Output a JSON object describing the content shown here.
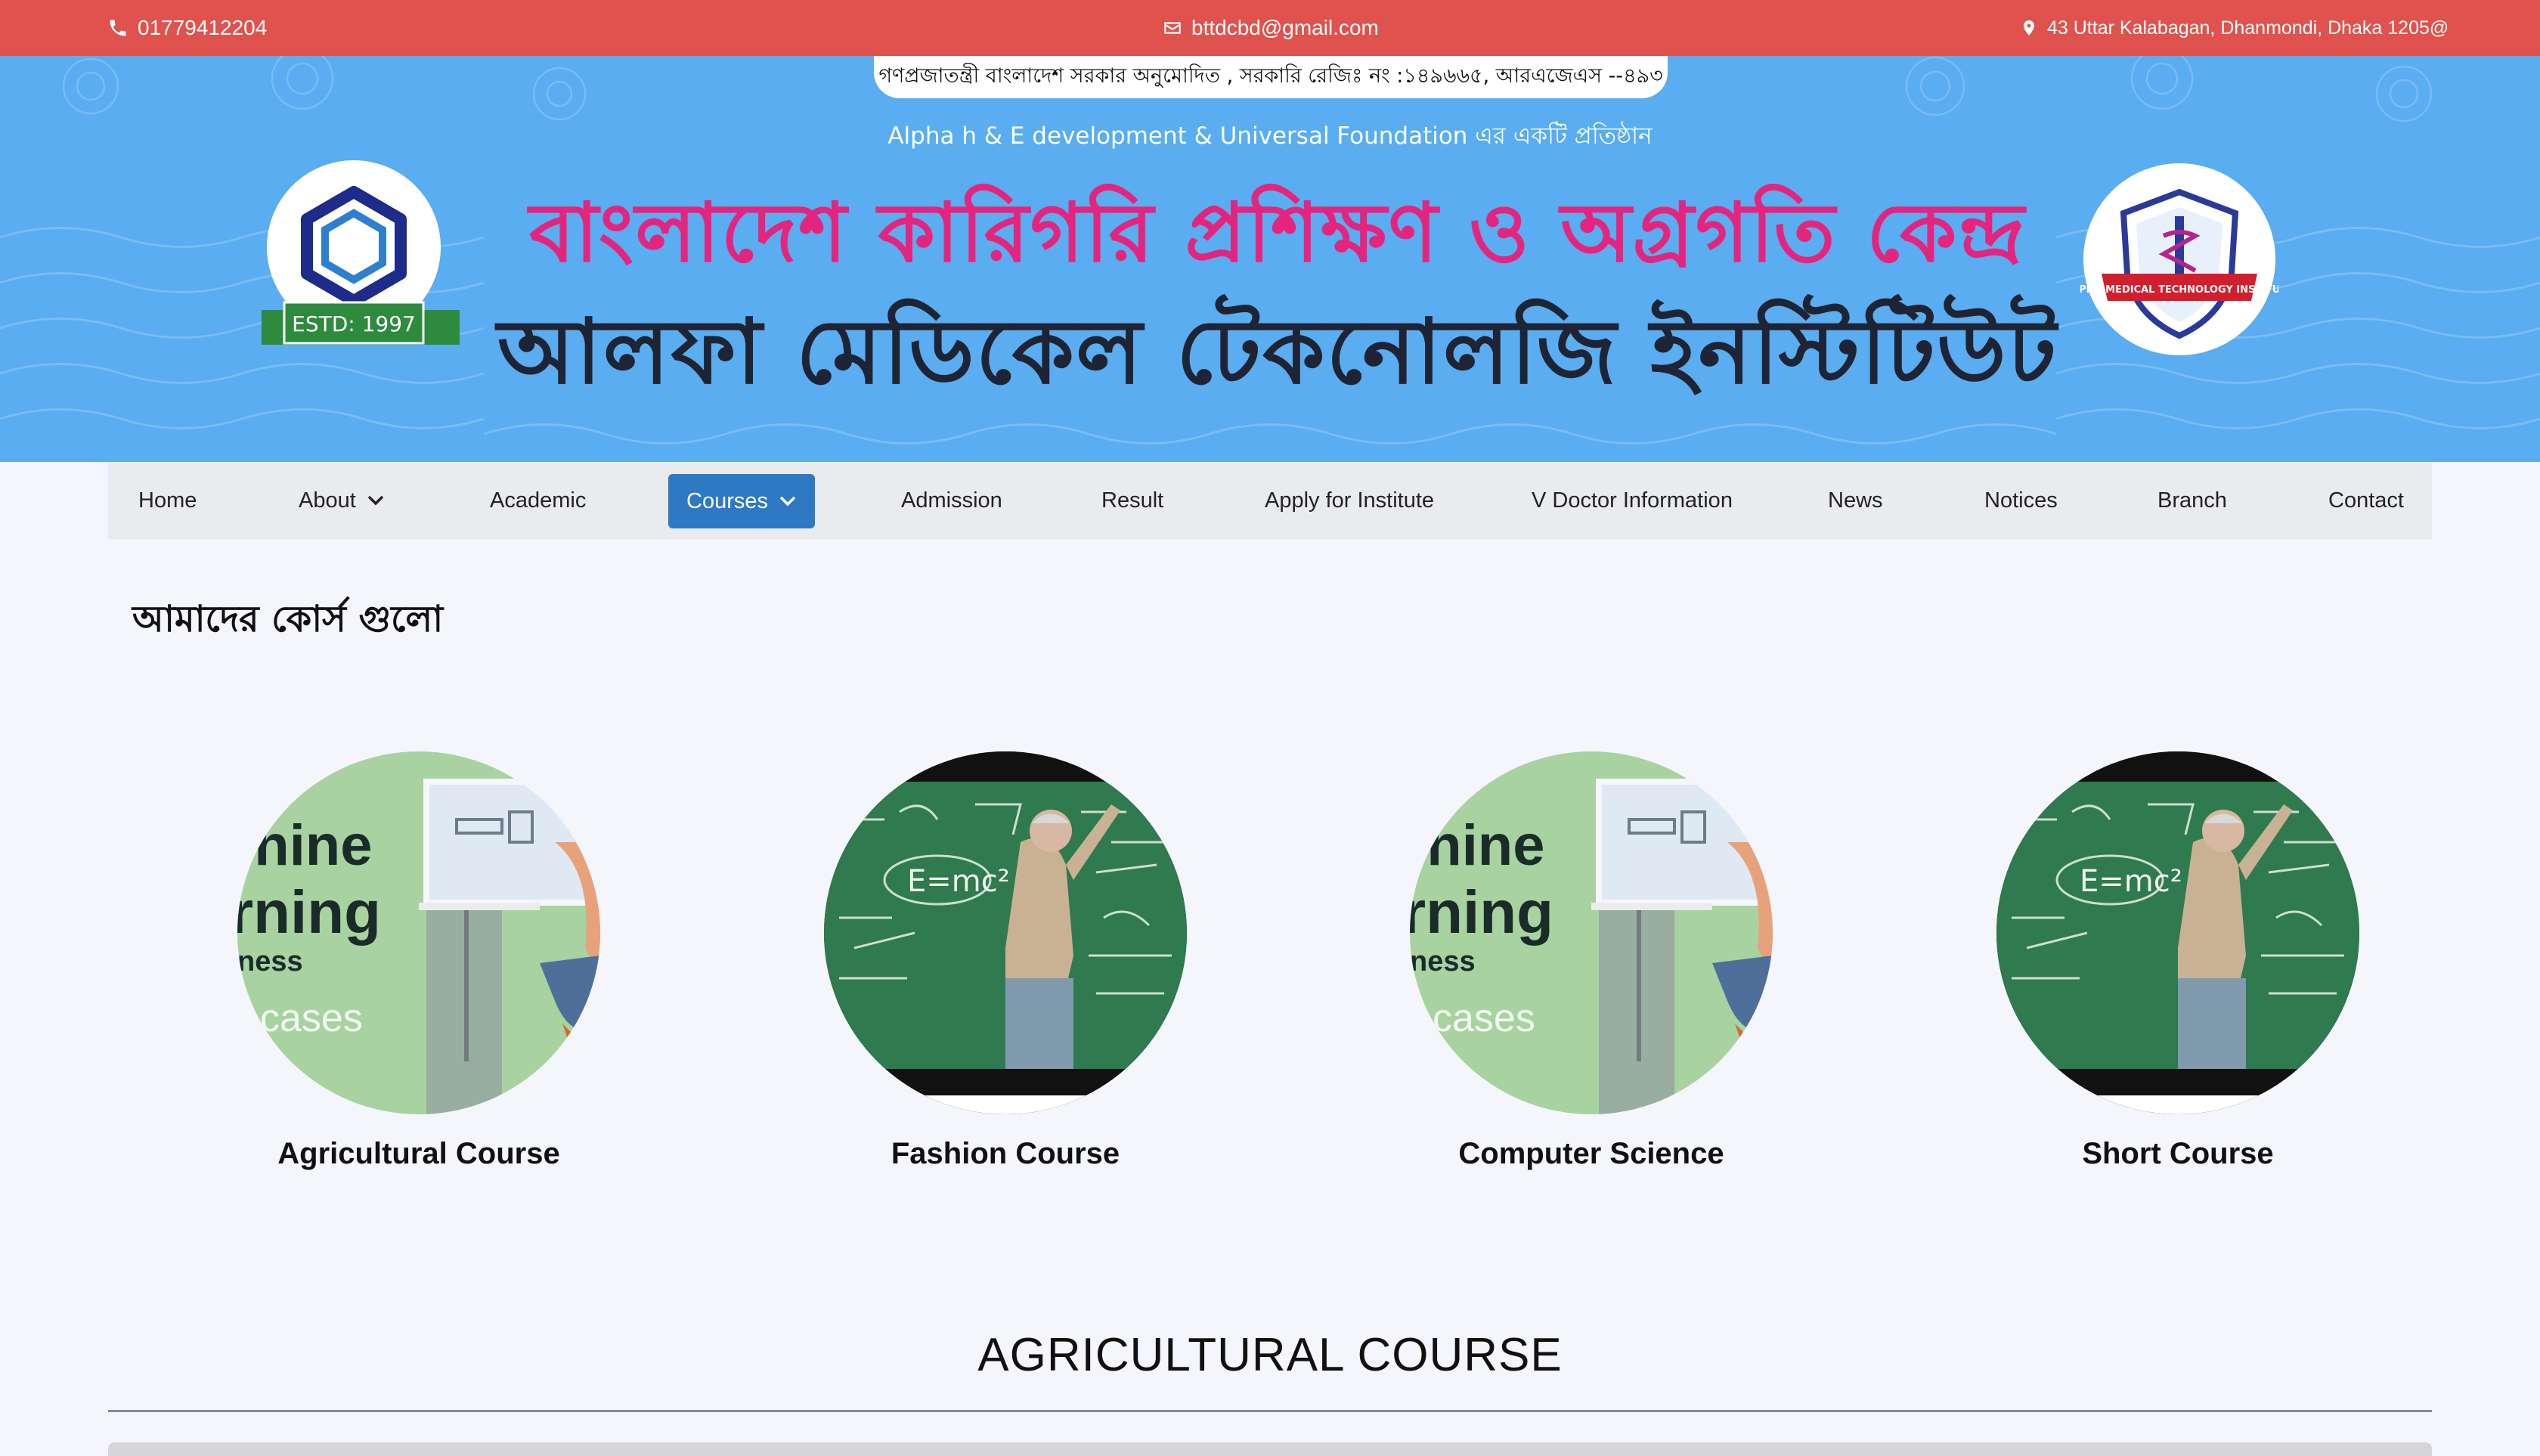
{
  "topbar": {
    "phone": "01779412204",
    "email": "bttdcbd@gmail.com",
    "address": "43 Uttar Kalabagan, Dhanmondi, Dhaka 1205@",
    "icons": [
      "phone-icon",
      "envelope-icon",
      "map-pin-icon"
    ]
  },
  "banner": {
    "gov_notice": "গণপ্রজাতন্ত্রী বাংলাদেশ সরকার অনুমোদিত , সরকারি রেজিঃ নং :১৪৯৬৬৫, আরএজেএস --৪৯৩",
    "subtitle": "Alpha h & E development & Universal Foundation এর একটি প্রতিষ্ঠান",
    "title_line1": "বাংলাদেশ কারিগরি প্রশিক্ষণ ও অগ্রগতি কেন্দ্র",
    "title_line2": "আলফা মেডিকেল টেকনোলজি ইনস্টিটিউট",
    "left_logo_text": "ESTD: 1997",
    "right_logo_text": "ALPHA MEDICAL TECHNOLOGY INSTITUTE",
    "colors": {
      "background": "#59adf0",
      "title1": "#e5257d",
      "title2": "#1e2434"
    }
  },
  "nav": {
    "items": [
      {
        "label": "Home"
      },
      {
        "label": "About",
        "dropdown": true
      },
      {
        "label": "Academic"
      },
      {
        "label": "Courses",
        "dropdown": true,
        "active": true
      },
      {
        "label": "Admission"
      },
      {
        "label": "Result"
      },
      {
        "label": "Apply for Institute"
      },
      {
        "label": "V Doctor Information"
      },
      {
        "label": "News"
      },
      {
        "label": "Notices"
      },
      {
        "label": "Branch"
      },
      {
        "label": "Contact"
      }
    ],
    "active_color": "#2f78c3"
  },
  "courses": {
    "heading": "আমাদের কোর্স গুলো",
    "items": [
      {
        "title": "Agricultural Course",
        "image": "machine-learning-illustration"
      },
      {
        "title": "Fashion Course",
        "image": "chalkboard-teacher-photo"
      },
      {
        "title": "Computer Science",
        "image": "machine-learning-illustration"
      },
      {
        "title": "Short Course",
        "image": "chalkboard-teacher-photo"
      }
    ],
    "ml_image_text": [
      "chine",
      "rning",
      "ness",
      "cases"
    ]
  },
  "section": {
    "heading": "AGRICULTURAL COURSE"
  }
}
